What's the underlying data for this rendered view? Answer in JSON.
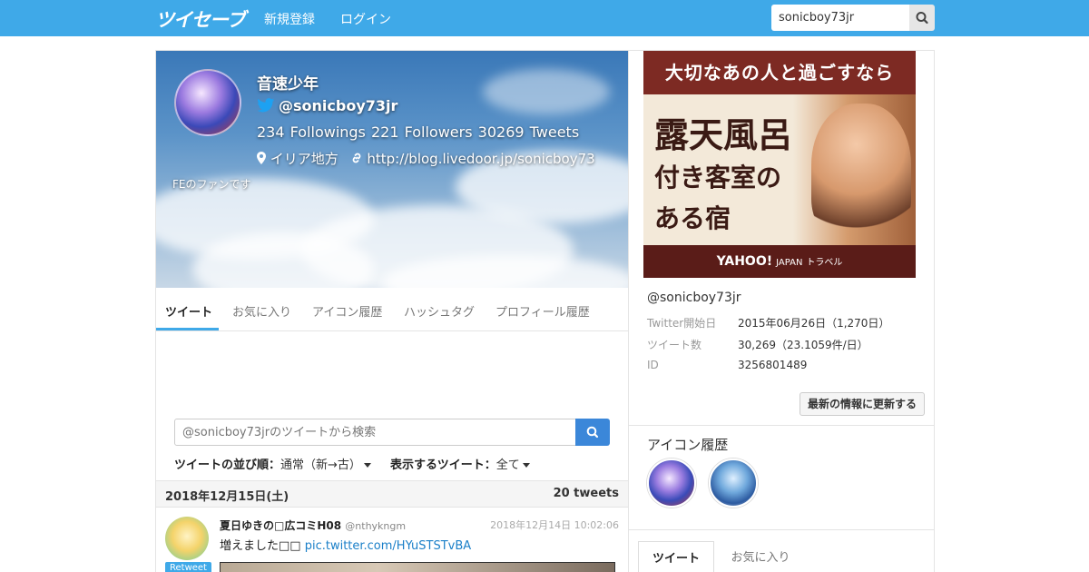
{
  "nav": {
    "logo": "ツイセーブ",
    "register": "新規登録",
    "login": "ログイン",
    "search_value": "sonicboy73jr"
  },
  "profile": {
    "name": "音速少年",
    "handle": "@sonicboy73jr",
    "followings": "234 Followings",
    "followers": "221 Followers",
    "tweets": "30269 Tweets",
    "location": "イリア地方",
    "url": "http://blog.livedoor.jp/sonicboy73",
    "bio": "FEのファンです"
  },
  "tabs": [
    "ツイート",
    "お気に入り",
    "アイコン履歴",
    "ハッシュタグ",
    "プロフィール履歴"
  ],
  "tweet_search": {
    "placeholder": "@sonicboy73jrのツイートから検索"
  },
  "sort": {
    "order_label": "ツイートの並び順：",
    "order_value": "通常（新→古）",
    "display_label": "表示するツイート：",
    "display_value": "全て"
  },
  "date_bar": {
    "date": "2018年12月15日(土)",
    "count": "20 tweets"
  },
  "tweet": {
    "author": "夏日ゆきの□広コミH08",
    "screen_name": "@nthykngm",
    "time": "2018年12月14日 10:02:06",
    "text": "増えました□□ ",
    "link": "pic.twitter.com/HYuSTSTvBA",
    "badge": "Retweet"
  },
  "ad": {
    "top": "大切なあの人と過ごすなら",
    "line1": "露天風呂",
    "line2": "付き客室の",
    "line3": "ある宿",
    "brand": "YAHOO!",
    "brand_sub": "JAPAN",
    "brand_suffix": "トラベル"
  },
  "side": {
    "handle": "@sonicboy73jr",
    "info": [
      {
        "label": "Twitter開始日",
        "value": "2015年06月26日（1,270日）"
      },
      {
        "label": "ツイート数",
        "value": "30,269（23.1059件/日）"
      },
      {
        "label": "ID",
        "value": "3256801489"
      }
    ],
    "refresh": "最新の情報に更新する",
    "icon_history_title": "アイコン履歴",
    "tabs": [
      "ツイート",
      "お気に入り"
    ]
  },
  "colors": {
    "nav_bg": "#3fa9e8",
    "accent": "#3fa9e8",
    "button_blue": "#3b87d9"
  }
}
